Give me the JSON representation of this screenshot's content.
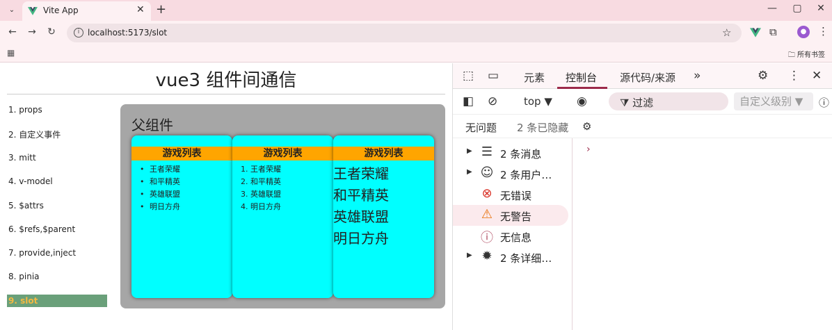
{
  "browser": {
    "tab_title": "Vite App",
    "url": "localhost:5173/slot",
    "bookmarks_folder": "所有书签",
    "accent": "#f8dbe1"
  },
  "page": {
    "title": "vue3 组件间通信",
    "nav": [
      {
        "label": "1. props"
      },
      {
        "label": "2. 自定义事件"
      },
      {
        "label": "3. mitt"
      },
      {
        "label": "4. v-model"
      },
      {
        "label": "5. $attrs"
      },
      {
        "label": "6. $refs,$parent"
      },
      {
        "label": "7. provide,inject"
      },
      {
        "label": "8. pinia"
      },
      {
        "label": "9. slot"
      }
    ],
    "parent_title": "父组件",
    "cards": [
      {
        "title": "游戏列表",
        "style": "ul",
        "items": [
          "王者荣耀",
          "和平精英",
          "英雄联盟",
          "明日方舟"
        ]
      },
      {
        "title": "游戏列表",
        "style": "ol",
        "items": [
          "1. 王者荣耀",
          "2. 和平精英",
          "3. 英雄联盟",
          "4. 明日方舟"
        ]
      },
      {
        "title": "游戏列表",
        "style": "big",
        "items": [
          "王者荣耀",
          "和平精英",
          "英雄联盟",
          "明日方舟"
        ]
      }
    ]
  },
  "devtools": {
    "tabs": [
      "元素",
      "控制台",
      "源代码/来源"
    ],
    "context": "top ▼",
    "filter_placeholder": "过滤",
    "level": "自定义级别 ▼",
    "no_issues": "无问题",
    "hidden": "2 条已隐藏",
    "sidebar": [
      {
        "label": "2 条消息",
        "icon": "list-icon"
      },
      {
        "label": "2 条用户…",
        "icon": "user-icon"
      },
      {
        "label": "无错误",
        "icon": "error-icon"
      },
      {
        "label": "无警告",
        "icon": "warning-icon"
      },
      {
        "label": "无信息",
        "icon": "info-icon"
      },
      {
        "label": "2 条详细…",
        "icon": "bug-icon"
      }
    ],
    "prompt": "›"
  }
}
